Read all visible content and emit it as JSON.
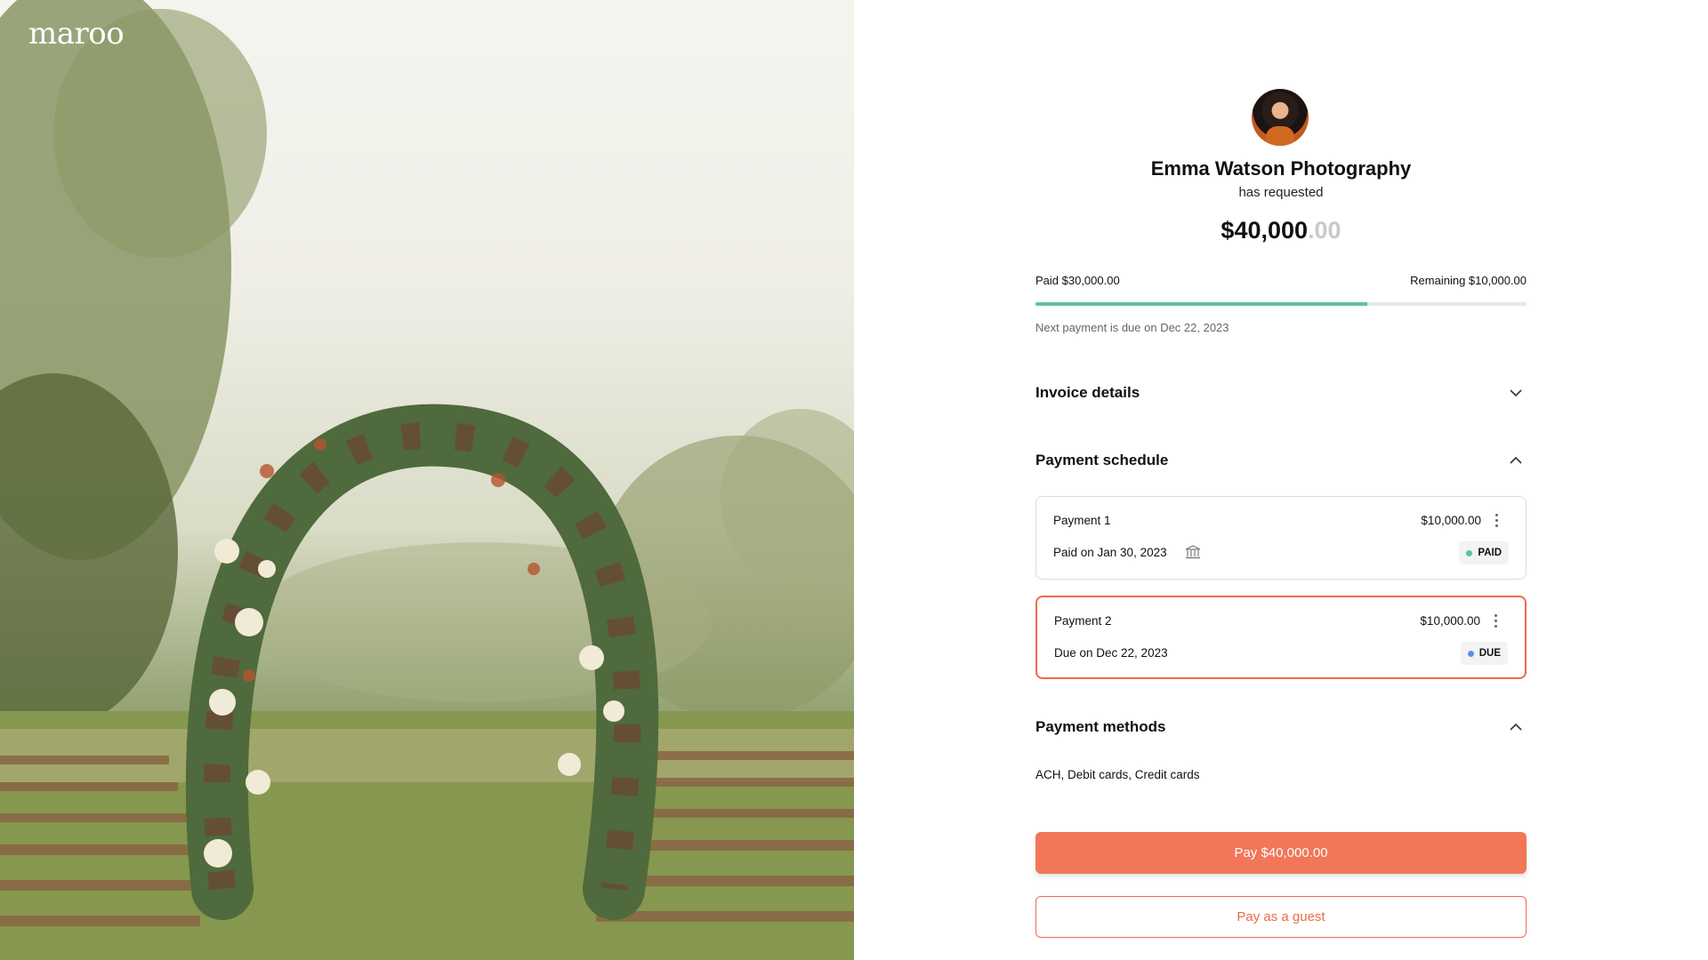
{
  "logo": "maroo",
  "requester": {
    "name": "Emma Watson Photography",
    "subtitle": "has requested",
    "amount_main": "$40,000",
    "amount_cents": ".00"
  },
  "progress": {
    "paid_label": "Paid $30,000.00",
    "remaining_label": "Remaining $10,000.00",
    "paid_fraction": 0.675,
    "next_due": "Next payment is due on Dec 22, 2023"
  },
  "sections": {
    "invoice_details": "Invoice details",
    "payment_schedule": "Payment schedule",
    "payment_methods": "Payment methods"
  },
  "payments": [
    {
      "title": "Payment 1",
      "amount": "$10,000.00",
      "sub": "Paid on Jan 30, 2023",
      "status": "PAID",
      "status_color": "#5cc39a"
    },
    {
      "title": "Payment 2",
      "amount": "$10,000.00",
      "sub": "Due on Dec 22, 2023",
      "status": "DUE",
      "status_color": "#5b8ff0"
    }
  ],
  "methods_text": "ACH, Debit cards, Credit cards",
  "buttons": {
    "pay": "Pay $40,000.00",
    "guest": "Pay as a guest"
  },
  "colors": {
    "accent": "#f17758",
    "progress": "#5cc39a"
  },
  "icons": {
    "chevron_collapsed": "chevron-down-icon",
    "chevron_expanded": "chevron-up-icon",
    "bank": "bank-icon",
    "more": "more-vertical-icon"
  }
}
